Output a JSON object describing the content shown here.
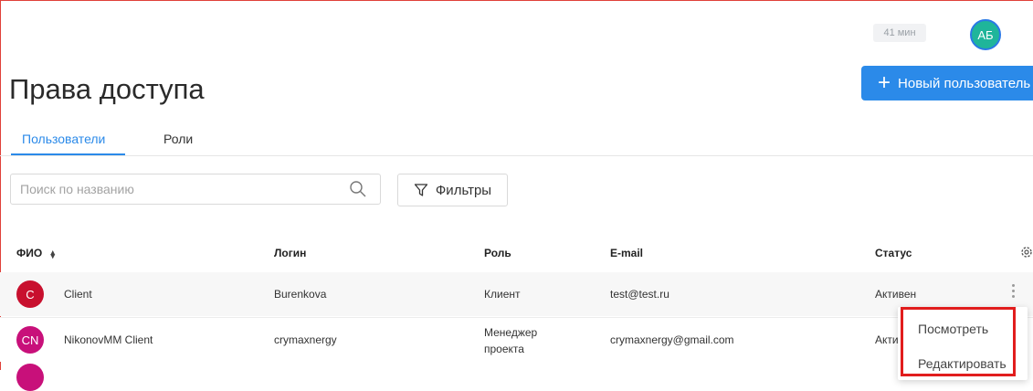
{
  "header": {
    "timer": "41 мин",
    "user_initials": "АБ",
    "new_user_label": "Новый пользователь"
  },
  "page": {
    "title": "Права доступа"
  },
  "tabs": [
    {
      "label": "Пользователи",
      "active": true
    },
    {
      "label": "Роли",
      "active": false
    }
  ],
  "search": {
    "placeholder": "Поиск по названию",
    "value": ""
  },
  "filters_label": "Фильтры",
  "table": {
    "headers": {
      "fio": "ФИО",
      "login": "Логин",
      "role": "Роль",
      "email": "E-mail",
      "status": "Статус"
    },
    "rows": [
      {
        "initials": "C",
        "name": "Client",
        "login": "Burenkova",
        "role": "Клиент",
        "email": "test@test.ru",
        "status": "Активен"
      },
      {
        "initials": "CN",
        "name": "NikonovMM Client",
        "login": "crymaxnergy",
        "role": "Менеджер проекта",
        "email": "crymaxnergy@gmail.com",
        "status": "Активен"
      }
    ]
  },
  "row_menu": {
    "view": "Посмотреть",
    "edit": "Редактировать"
  },
  "colors": {
    "accent": "#2b8ae9",
    "avatar_top": "#1fb59a",
    "avatar_row1": "#c8102e",
    "avatar_row2": "#c8107a",
    "highlight": "#e11d1d"
  }
}
